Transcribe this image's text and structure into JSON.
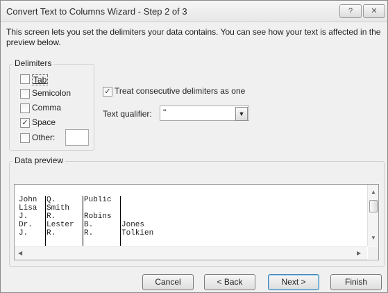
{
  "window": {
    "title": "Convert Text to Columns Wizard - Step 2 of 3",
    "help_label": "?",
    "close_label": "✕"
  },
  "description": "This screen lets you set the delimiters your data contains.  You can see how your text is affected in the preview below.",
  "delimiters": {
    "group_label": "Delimiters",
    "tab": {
      "label": "Tab",
      "checked": false
    },
    "semicolon": {
      "label": "Semicolon",
      "checked": false
    },
    "comma": {
      "label": "Comma",
      "checked": false
    },
    "space": {
      "label": "Space",
      "checked": true
    },
    "other": {
      "label": "Other:",
      "checked": false,
      "value": ""
    }
  },
  "consecutive": {
    "label": "Treat consecutive delimiters as one",
    "checked": true
  },
  "qualifier": {
    "label": "Text qualifier:",
    "value": "\""
  },
  "preview": {
    "group_label": "Data preview",
    "rows": [
      [
        "John",
        "Q.",
        "Public",
        ""
      ],
      [
        "Lisa",
        "Smith",
        "",
        ""
      ],
      [
        "J.",
        "R.",
        "Robins",
        ""
      ],
      [
        "Dr.",
        "Lester",
        "B.",
        "Jones"
      ],
      [
        "J.",
        "R.",
        "R.",
        "Tolkien"
      ]
    ]
  },
  "buttons": {
    "cancel": "Cancel",
    "back": "< Back",
    "next": "Next >",
    "finish": "Finish"
  }
}
